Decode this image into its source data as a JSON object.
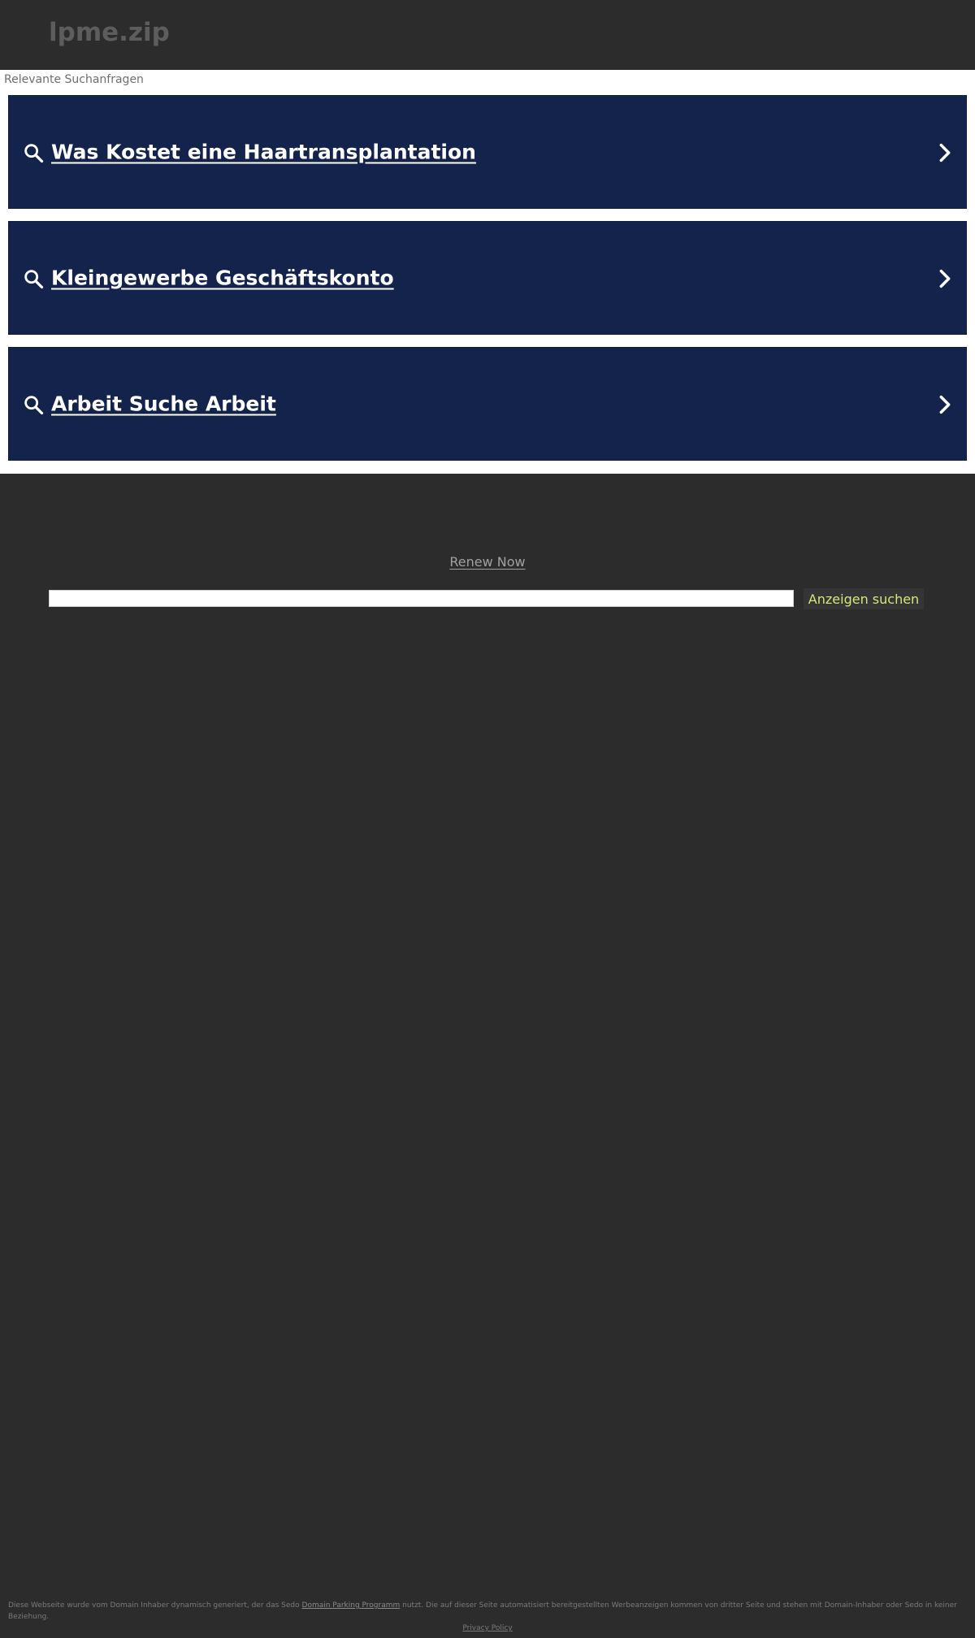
{
  "header": {
    "domain": "lpme.zip"
  },
  "related": {
    "heading": "Relevante Suchanfragen",
    "items": [
      {
        "label": "Was Kostet eine Haartransplantation"
      },
      {
        "label": "Kleingewerbe Geschäftskonto"
      },
      {
        "label": "Arbeit Suche Arbeit"
      }
    ]
  },
  "renew": {
    "label": "Renew Now"
  },
  "search": {
    "value": "",
    "button_label": "Anzeigen suchen"
  },
  "footer": {
    "disclaimer_before": "Diese Webseite wurde vom Domain Inhaber dynamisch generiert, der das Sedo ",
    "disclaimer_link": "Domain Parking Programm",
    "disclaimer_after": " nutzt. Die auf dieser Seite automatisiert bereitgestellten Werbeanzeigen kommen von dritter Seite und stehen mit Domain-Inhaber oder Sedo in keiner Beziehung.",
    "privacy_label": "Privacy Policy"
  },
  "colors": {
    "background": "#2c2c2c",
    "item_background": "#13234c",
    "button_text": "#d6e77a"
  }
}
